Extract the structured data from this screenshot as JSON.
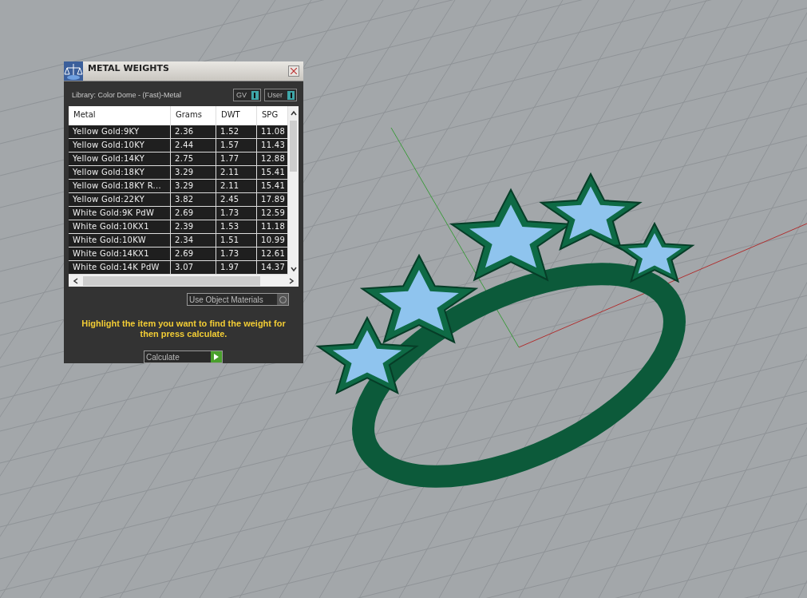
{
  "panel": {
    "title": "METAL WEIGHTS",
    "library": "Library: Color Dome - (Fast)-Metal",
    "toggles": [
      {
        "label": "GV",
        "on": true
      },
      {
        "label": "User",
        "on": true
      }
    ],
    "table": {
      "columns": [
        "Metal",
        "Grams",
        "DWT",
        "SPG"
      ],
      "rows": [
        [
          "Yellow Gold:9KY",
          "2.36",
          "1.52",
          "11.08"
        ],
        [
          "Yellow Gold:10KY",
          "2.44",
          "1.57",
          "11.43"
        ],
        [
          "Yellow Gold:14KY",
          "2.75",
          "1.77",
          "12.88"
        ],
        [
          "Yellow Gold:18KY",
          "3.29",
          "2.11",
          "15.41"
        ],
        [
          "Yellow Gold:18KY R...",
          "3.29",
          "2.11",
          "15.41"
        ],
        [
          "Yellow Gold:22KY",
          "3.82",
          "2.45",
          "17.89"
        ],
        [
          "White Gold:9K PdW",
          "2.69",
          "1.73",
          "12.59"
        ],
        [
          "White Gold:10KX1",
          "2.39",
          "1.53",
          "11.18"
        ],
        [
          "White Gold:10KW",
          "2.34",
          "1.51",
          "10.99"
        ],
        [
          "White Gold:14KX1",
          "2.69",
          "1.73",
          "12.61"
        ],
        [
          "White Gold:14K PdW",
          "3.07",
          "1.97",
          "14.37"
        ]
      ]
    },
    "use_object_materials": {
      "label": "Use Object Materials",
      "checked": false
    },
    "hint": "Highlight the item you want to find the weight for then press calculate.",
    "calculate_button": "Calculate"
  }
}
